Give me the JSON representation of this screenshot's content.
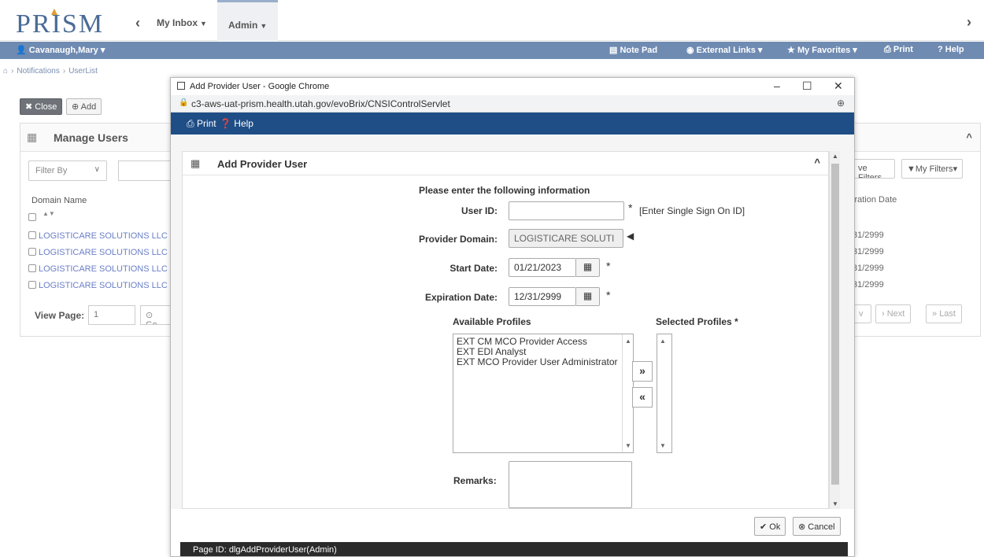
{
  "app": {
    "logo_text": "PRISM"
  },
  "nav": {
    "inbox_label": "My Inbox",
    "admin_label": "Admin"
  },
  "userbar": {
    "user": "Cavanaugh,Mary",
    "note_pad": "Note Pad",
    "external_links": "External Links",
    "my_favorites": "My Favorites",
    "print": "Print",
    "help": "Help"
  },
  "breadcrumb": {
    "items": [
      "Notifications",
      "UserList"
    ]
  },
  "toolbar": {
    "close_label": "Close",
    "add_label": "Add"
  },
  "manage_users": {
    "title": "Manage Users",
    "filter_by_placeholder": "Filter By",
    "col_domain": "Domain Name",
    "col_expiration": "iration Date",
    "rows": [
      {
        "domain": "LOGISTICARE SOLUTIONS LLC",
        "expiration": "31/2999"
      },
      {
        "domain": "LOGISTICARE SOLUTIONS LLC",
        "expiration": "31/2999"
      },
      {
        "domain": "LOGISTICARE SOLUTIONS LLC",
        "expiration": "31/2999"
      },
      {
        "domain": "LOGISTICARE SOLUTIONS LLC",
        "expiration": "31/2999"
      }
    ],
    "view_page_label": "View Page:",
    "view_page_value": "1",
    "go_label": "Go",
    "save_filters_label": "ve Filters",
    "my_filters_label": "My Filters",
    "prev_label": "v",
    "next_label": "Next",
    "last_label": "Last"
  },
  "popup": {
    "window_title": "Add Provider User - Google Chrome",
    "url": "c3-aws-uat-prism.health.utah.gov/evoBrix/CNSIControlServlet",
    "print_label": "Print",
    "help_label": "Help",
    "panel_title": "Add Provider User",
    "instructions": "Please enter the following information",
    "user_id_label": "User ID:",
    "user_id_value": "",
    "user_id_hint": "[Enter Single Sign On ID]",
    "provider_domain_label": "Provider Domain:",
    "provider_domain_value": "LOGISTICARE SOLUTI",
    "start_date_label": "Start Date:",
    "start_date_value": "01/21/2023",
    "expiration_date_label": "Expiration Date:",
    "expiration_date_value": "12/31/2999",
    "available_profiles_label": "Available Profiles",
    "selected_profiles_label": "Selected Profiles",
    "available_profiles": [
      "EXT CM MCO Provider Access",
      "EXT EDI Analyst",
      "EXT MCO Provider User Administrator"
    ],
    "selected_profiles": [],
    "remarks_label": "Remarks:",
    "remarks_value": "",
    "ok_label": "Ok",
    "cancel_label": "Cancel",
    "page_id": "Page ID: dlgAddProviderUser(Admin)"
  }
}
